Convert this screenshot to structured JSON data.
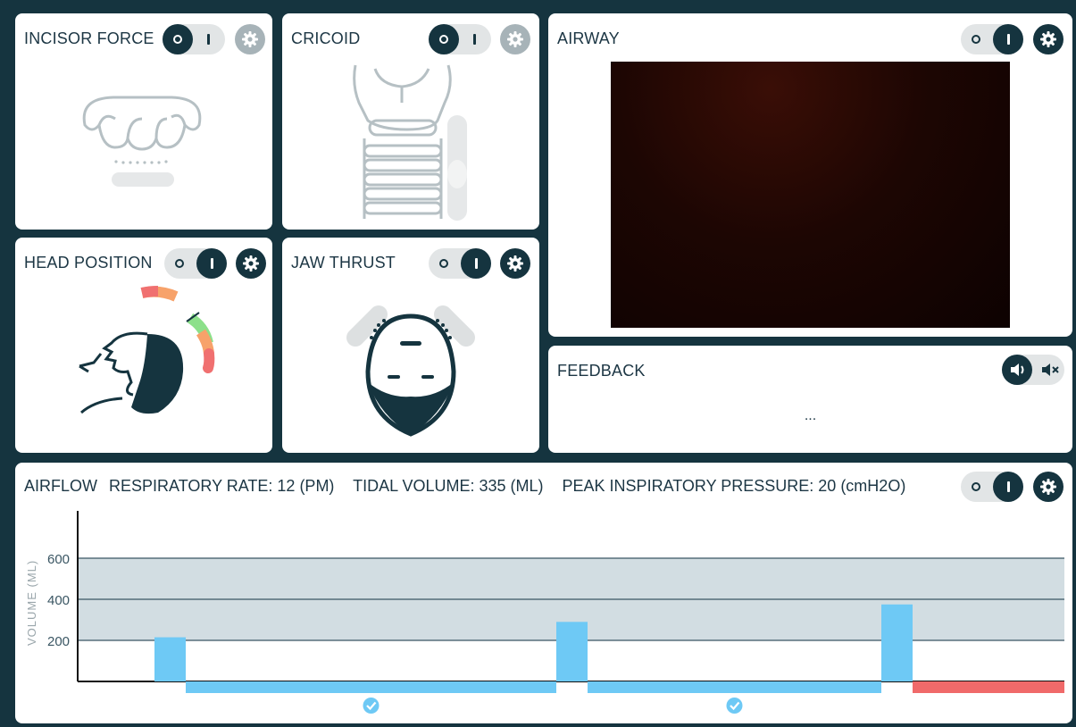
{
  "panels": {
    "incisor": {
      "title": "INCISOR FORCE",
      "power": "off",
      "settings_enabled": false
    },
    "cricoid": {
      "title": "CRICOID",
      "power": "off",
      "settings_enabled": false
    },
    "airway": {
      "title": "AIRWAY",
      "power": "on",
      "settings_enabled": true
    },
    "head": {
      "title": "HEAD POSITION",
      "power": "on",
      "settings_enabled": true
    },
    "jaw": {
      "title": "JAW THRUST",
      "power": "on",
      "settings_enabled": true
    },
    "feedback": {
      "title": "FEEDBACK",
      "text": "...",
      "sound": "on"
    }
  },
  "airflow": {
    "title": "AIRFLOW",
    "respiratory_rate": "RESPIRATORY RATE: 12 (PM)",
    "tidal_volume": "TIDAL VOLUME: 335 (ML)",
    "peak_pressure": "PEAK INSPIRATORY PRESSURE: 20 (cmH2O)",
    "power": "on"
  },
  "chart_data": {
    "type": "bar",
    "ylabel": "VOLUME (ML)",
    "yticks": [
      200,
      400,
      600
    ],
    "ylim": [
      0,
      800
    ],
    "target_band": [
      200,
      600
    ],
    "breaths": [
      215,
      290,
      375
    ],
    "exhale_segments": [
      {
        "status": "ok",
        "marker": "check"
      },
      {
        "status": "ok",
        "marker": "check"
      },
      {
        "status": "error",
        "marker": ""
      }
    ],
    "colors": {
      "bar": "#6ec9f5",
      "error": "#f06a6a",
      "band": "#d2dde2",
      "check": "#6ec9f5"
    }
  }
}
